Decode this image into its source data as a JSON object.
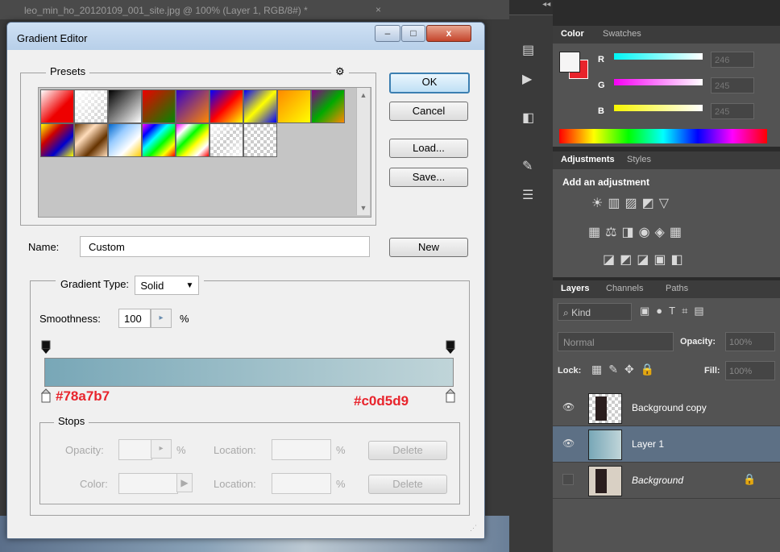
{
  "document": {
    "tab_title": "leo_min_ho_20120109_001_site.jpg @ 100% (Layer 1, RGB/8#) *",
    "tab_close": "×"
  },
  "dialog": {
    "title": "Gradient Editor",
    "window_buttons": {
      "minimize": "–",
      "maximize": "□",
      "close": "x"
    },
    "presets": {
      "label": "Presets",
      "gear": "⚙",
      "swatch_count": 16
    },
    "buttons": {
      "ok": "OK",
      "cancel": "Cancel",
      "load": "Load...",
      "save": "Save...",
      "new": "New"
    },
    "name": {
      "label": "Name:",
      "value": "Custom"
    },
    "gradient_type": {
      "label": "Gradient Type:",
      "value": "Solid"
    },
    "smoothness": {
      "label": "Smoothness:",
      "value": "100",
      "unit": "%"
    },
    "gradient": {
      "start_color": "#78a7b7",
      "end_color": "#c0d5d9",
      "start_label": "#78a7b7",
      "end_label": "#c0d5d9",
      "label_color": "#e8242c"
    },
    "stops": {
      "label": "Stops",
      "opacity_label": "Opacity:",
      "opacity_unit": "%",
      "color_label": "Color:",
      "location_label": "Location:",
      "location_unit": "%",
      "delete": "Delete"
    }
  },
  "color_panel": {
    "tabs": [
      "Color",
      "Swatches"
    ],
    "channels": [
      {
        "name": "R",
        "value": "246"
      },
      {
        "name": "G",
        "value": "245"
      },
      {
        "name": "B",
        "value": "245"
      }
    ]
  },
  "adjustments_panel": {
    "tabs": [
      "Adjustments",
      "Styles"
    ],
    "heading": "Add an adjustment"
  },
  "layers_panel": {
    "tabs": [
      "Layers",
      "Channels",
      "Paths"
    ],
    "kind": "Kind",
    "blend_mode": "Normal",
    "opacity_label": "Opacity:",
    "opacity_value": "100%",
    "lock_label": "Lock:",
    "fill_label": "Fill:",
    "fill_value": "100%",
    "layers": [
      {
        "name": "Background copy"
      },
      {
        "name": "Layer 1"
      },
      {
        "name": "Background"
      }
    ]
  }
}
